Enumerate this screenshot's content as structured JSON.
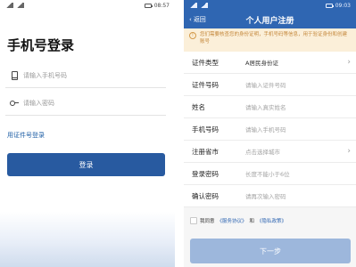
{
  "left": {
    "status": {
      "time": "08:57"
    },
    "title": "手机号登录",
    "phone": {
      "placeholder": "请输入手机号码"
    },
    "password": {
      "placeholder": "请输入密码"
    },
    "id_login_link": "用证件号登录",
    "login_button": "登录"
  },
  "right": {
    "status": {
      "time": "09:03"
    },
    "nav": {
      "back_label": "返回",
      "title": "个人用户注册"
    },
    "notice": "您们需要核查您的身份证明，手机号码等信息，用于验证身份和创建账号",
    "rows": [
      {
        "label": "证件类型",
        "value": "A居民身份证",
        "placeholder": "",
        "chevron": true
      },
      {
        "label": "证件号码",
        "value": "",
        "placeholder": "请输入证件号码",
        "chevron": false
      },
      {
        "label": "姓名",
        "value": "",
        "placeholder": "请输入真实姓名",
        "chevron": false
      },
      {
        "label": "手机号码",
        "value": "",
        "placeholder": "请输入手机号码",
        "chevron": false
      },
      {
        "label": "注册省市",
        "value": "",
        "placeholder": "点击选择城市",
        "chevron": true
      },
      {
        "label": "登录密码",
        "value": "",
        "placeholder": "长度不能小于6位",
        "chevron": false
      },
      {
        "label": "确认密码",
        "value": "",
        "placeholder": "请再次输入密码",
        "chevron": false
      }
    ],
    "agreement": {
      "prefix": "我同意",
      "service": "《服务协议》",
      "and": "和",
      "privacy": "《隐私政策》"
    },
    "next_button": "下一步"
  }
}
